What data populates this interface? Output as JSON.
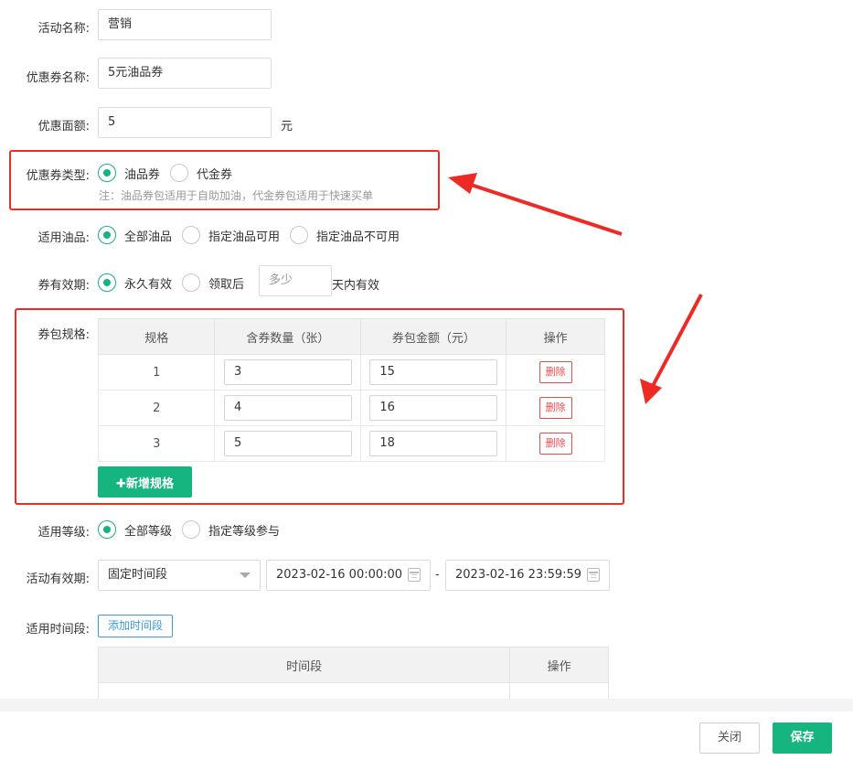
{
  "form": {
    "activity_name": {
      "label": "活动名称:",
      "value": "营销"
    },
    "coupon_name": {
      "label": "优惠券名称:",
      "value": "5元油品券"
    },
    "face_value": {
      "label": "优惠面额:",
      "value": "5",
      "unit": "元"
    },
    "coupon_type": {
      "label": "优惠券类型:",
      "options": [
        "油品券",
        "代金券"
      ],
      "selected": "油品券",
      "note": "注：油品券包适用于自助加油，代金券包适用于快速买单"
    },
    "applicable_products": {
      "label": "适用油品:",
      "options": [
        "全部油品",
        "指定油品可用",
        "指定油品不可用"
      ],
      "selected": "全部油品"
    },
    "validity": {
      "label": "券有效期:",
      "options": [
        "永久有效",
        "领取后"
      ],
      "selected": "永久有效",
      "days_placeholder": "多少",
      "days_suffix": "天内有效"
    },
    "package_spec": {
      "label": "券包规格:",
      "columns": [
        "规格",
        "含券数量（张）",
        "券包金额（元）",
        "操作"
      ],
      "rows": [
        {
          "spec": "1",
          "count": "3",
          "amount": "15",
          "action": "删除"
        },
        {
          "spec": "2",
          "count": "4",
          "amount": "16",
          "action": "删除"
        },
        {
          "spec": "3",
          "count": "5",
          "amount": "18",
          "action": "删除"
        }
      ],
      "add_button": "✚新增规格"
    },
    "applicable_level": {
      "label": "适用等级:",
      "options": [
        "全部等级",
        "指定等级参与"
      ],
      "selected": "全部等级"
    },
    "activity_period": {
      "label": "活动有效期:",
      "select_value": "固定时间段",
      "start": "2023-02-16 00:00:00",
      "separator": "-",
      "end": "2023-02-16 23:59:59"
    },
    "time_slots": {
      "label": "适用时间段:",
      "add_button": "添加时间段",
      "columns": [
        "时间段",
        "操作"
      ]
    }
  },
  "footer": {
    "close_label": "关闭",
    "save_label": "保存"
  },
  "colors": {
    "primary_green": "#16b47e",
    "annotation_red": "#ee2a24",
    "danger": "#e84a4a",
    "link_blue": "#3a9ad9"
  }
}
